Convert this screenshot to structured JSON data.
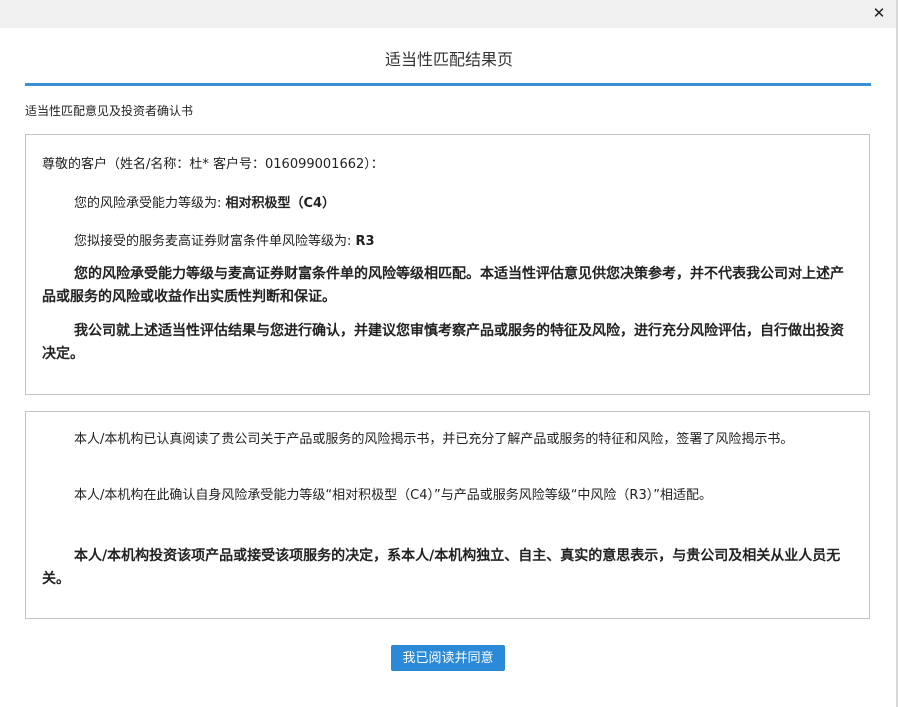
{
  "window": {
    "close_glyph": "✕"
  },
  "header": {
    "title": "适当性匹配结果页"
  },
  "section": {
    "label": "适当性匹配意见及投资者确认书"
  },
  "opinion": {
    "greeting": "尊敬的客户（姓名/名称：杜* 客户号：016099001662）：",
    "risk_capacity_prefix": "您的风险承受能力等级为: ",
    "risk_capacity_value": "相对积极型（C4）",
    "product_risk_prefix": "您拟接受的服务麦高证券财富条件单风险等级为: ",
    "product_risk_value": "R3",
    "match_statement": "您的风险承受能力等级与麦高证券财富条件单的风险等级相匹配。本适当性评估意见供您决策参考，并不代表我公司对上述产品或服务的风险或收益作出实质性判断和保证。",
    "confirm_statement": "我公司就上述适当性评估结果与您进行确认，并建议您审慎考察产品或服务的特征及风险，进行充分风险评估，自行做出投资决定。"
  },
  "investor_confirmation": {
    "para1": "本人/本机构已认真阅读了贵公司关于产品或服务的风险揭示书，并已充分了解产品或服务的特征和风险，签署了风险揭示书。",
    "para2": "本人/本机构在此确认自身风险承受能力等级“相对积极型（C4）”与产品或服务风险等级“中风险（R3）”相适配。",
    "para3": "本人/本机构投资该项产品或接受该项服务的决定，系本人/本机构独立、自主、真实的意思表示，与贵公司及相关从业人员无关。"
  },
  "actions": {
    "agree_label": "我已阅读并同意"
  },
  "colors": {
    "accent": "#2a8ad8",
    "rule": "#3a8fd6",
    "border": "#c4c4c4"
  }
}
